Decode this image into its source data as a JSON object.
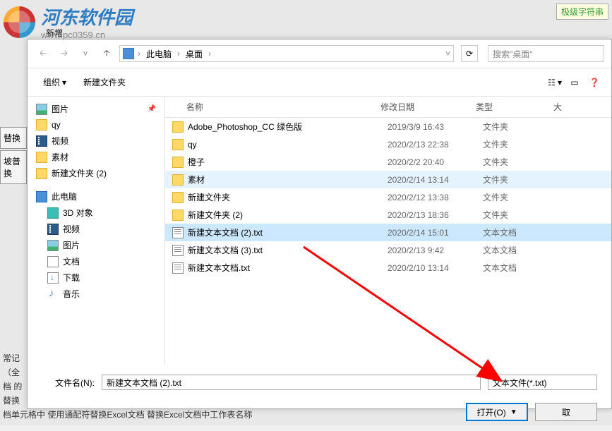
{
  "watermark": {
    "title": "河东软件园",
    "url": "www.pc0359.cn"
  },
  "background": {
    "new_label": "新增",
    "left_buttons": [
      "替换",
      "坡普换"
    ],
    "top_right": "极级字符串",
    "bottom_lines": [
      "常记",
      "（全",
      "档 的",
      "替换",
      "档单元格中        使用通配符替换Excel文档        替换Excel文档中工作表名称"
    ]
  },
  "dialog": {
    "breadcrumb": {
      "item1": "此电脑",
      "item2": "桌面"
    },
    "search_placeholder": "搜索\"桌面\"",
    "toolbar": {
      "organize": "组织",
      "new_folder": "新建文件夹"
    },
    "sidebar": {
      "items": [
        {
          "icon": "pic",
          "label": "图片",
          "pinned": true
        },
        {
          "icon": "folder",
          "label": "qy"
        },
        {
          "icon": "video",
          "label": "视频"
        },
        {
          "icon": "folder",
          "label": "素材"
        },
        {
          "icon": "folder",
          "label": "新建文件夹 (2)"
        }
      ],
      "pc_section": {
        "label": "此电脑",
        "items": [
          {
            "icon": "3d",
            "label": "3D 对象"
          },
          {
            "icon": "video",
            "label": "视频"
          },
          {
            "icon": "pic",
            "label": "图片"
          },
          {
            "icon": "doc",
            "label": "文档"
          },
          {
            "icon": "dl",
            "label": "下载"
          },
          {
            "icon": "music",
            "label": "音乐"
          }
        ]
      }
    },
    "columns": {
      "name": "名称",
      "date": "修改日期",
      "type": "类型",
      "size": "大"
    },
    "files": [
      {
        "icon": "folder",
        "name": "Adobe_Photoshop_CC 绿色版",
        "date": "2019/3/9 16:43",
        "type": "文件夹"
      },
      {
        "icon": "folder",
        "name": "qy",
        "date": "2020/2/13 22:38",
        "type": "文件夹"
      },
      {
        "icon": "folder",
        "name": "橙子",
        "date": "2020/2/2 20:40",
        "type": "文件夹"
      },
      {
        "icon": "folder",
        "name": "素材",
        "date": "2020/2/14 13:14",
        "type": "文件夹",
        "hover": true
      },
      {
        "icon": "folder",
        "name": "新建文件夹",
        "date": "2020/2/12 13:38",
        "type": "文件夹"
      },
      {
        "icon": "folder",
        "name": "新建文件夹 (2)",
        "date": "2020/2/13 18:36",
        "type": "文件夹"
      },
      {
        "icon": "txt",
        "name": "新建文本文档 (2).txt",
        "date": "2020/2/14 15:01",
        "type": "文本文档",
        "selected": true
      },
      {
        "icon": "txt",
        "name": "新建文本文档 (3).txt",
        "date": "2020/2/13 9:42",
        "type": "文本文档"
      },
      {
        "icon": "txt",
        "name": "新建文本文档.txt",
        "date": "2020/2/10 13:14",
        "type": "文本文档"
      }
    ],
    "filename_label": "文件名(N):",
    "filename_value": "新建文本文档 (2).txt",
    "filter_value": "文本文件(*.txt)",
    "open_btn": "打开(O)",
    "cancel_btn": "取"
  }
}
